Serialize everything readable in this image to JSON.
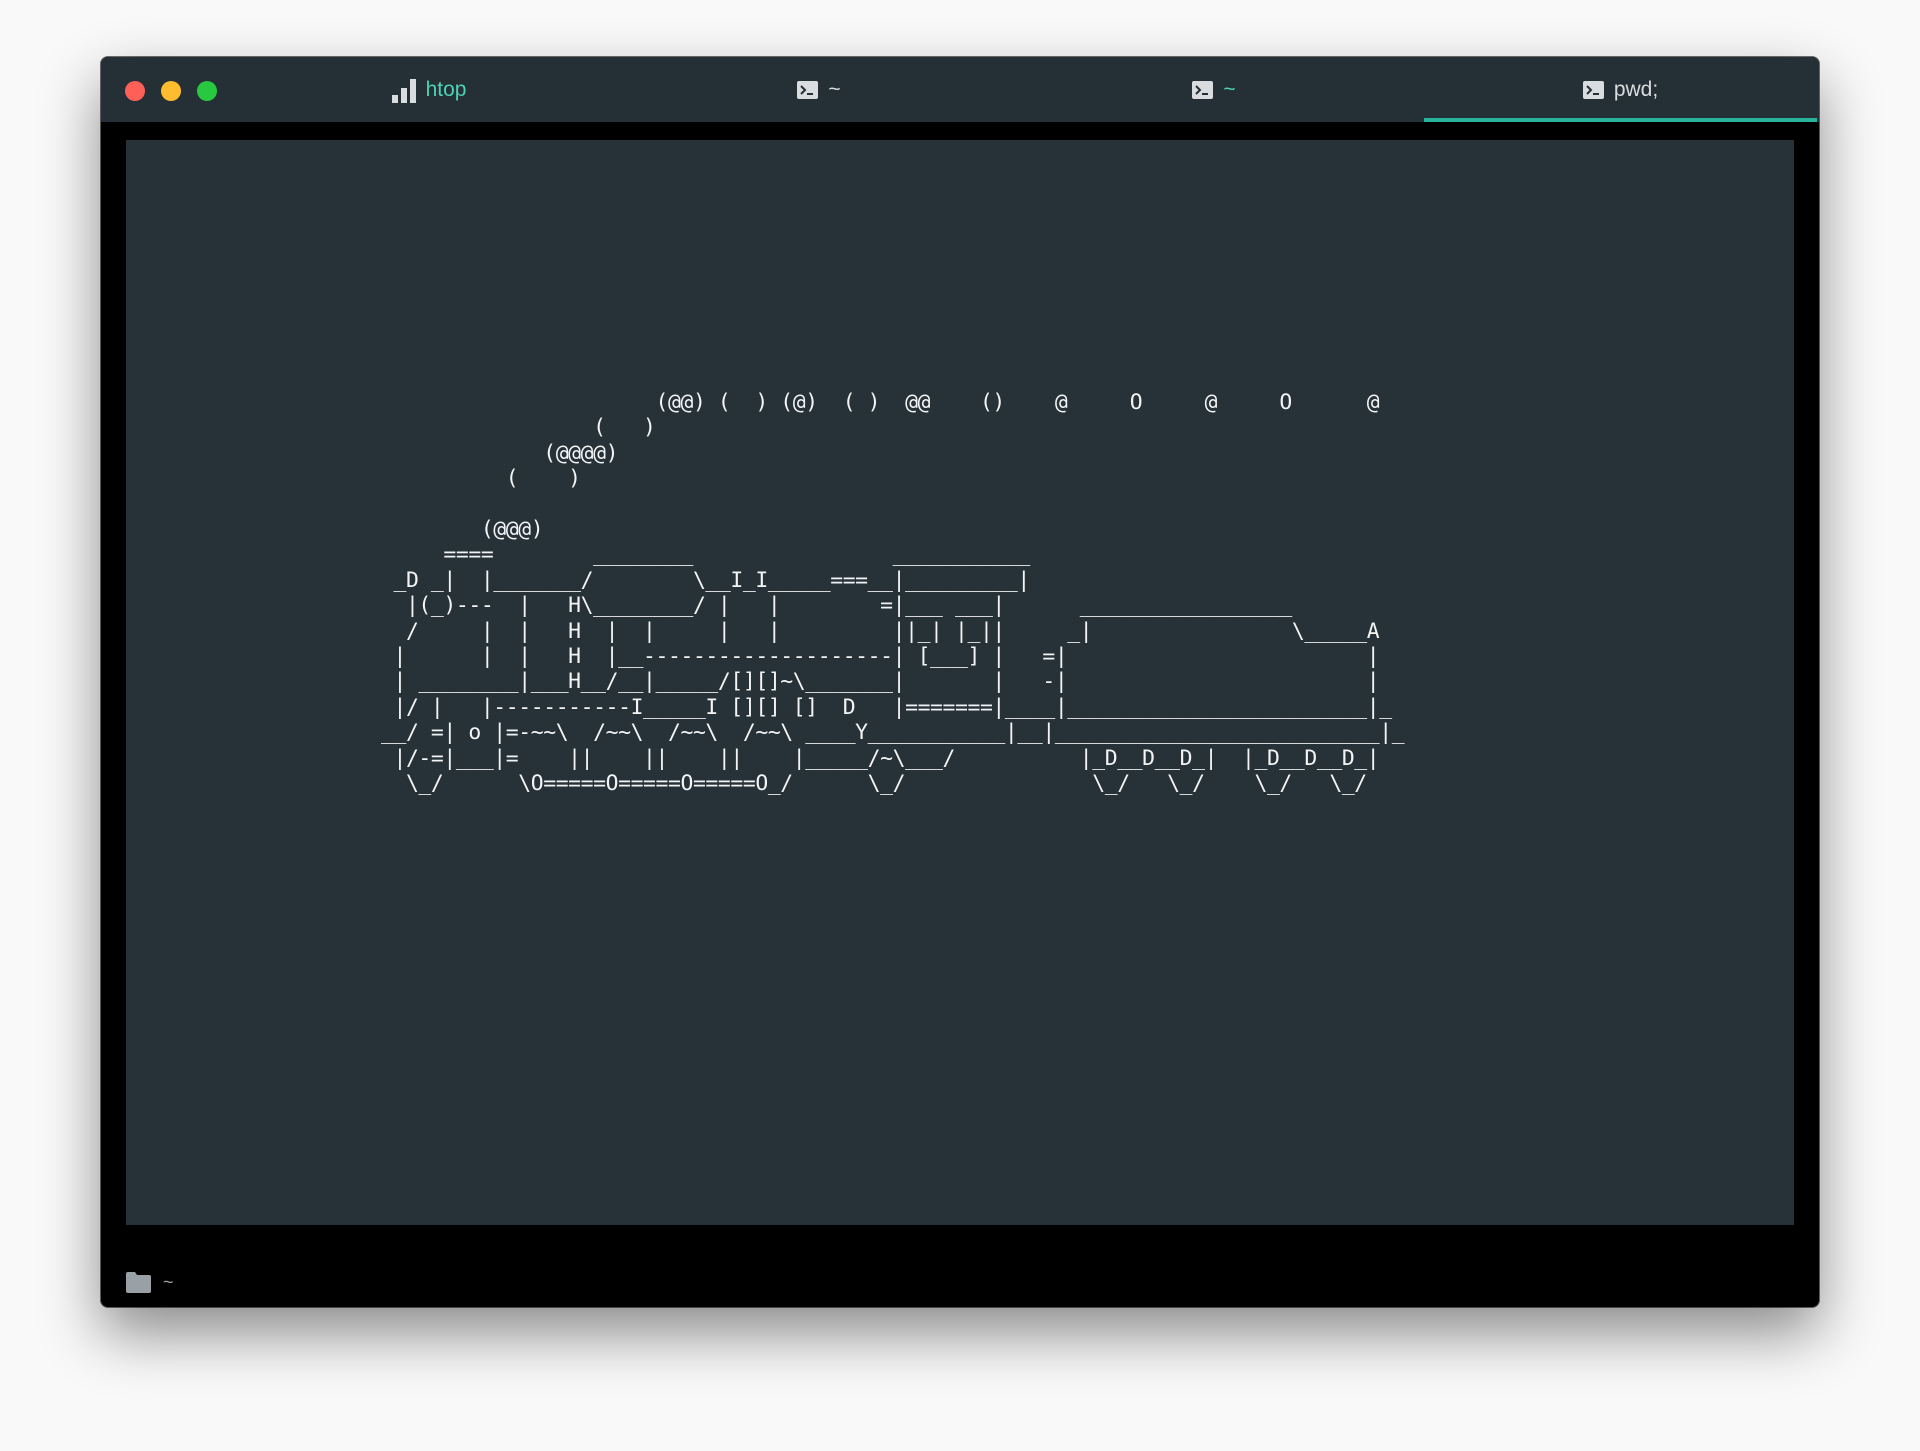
{
  "window": {
    "tabs": [
      {
        "label": "htop",
        "icon": "bar-chart-icon",
        "color": "#4ed1b4"
      },
      {
        "label": "~",
        "icon": "terminal-icon",
        "color": "#d9dde0"
      },
      {
        "label": "~",
        "icon": "terminal-icon",
        "color": "#4ed1b4"
      },
      {
        "label": "pwd;",
        "icon": "terminal-icon",
        "color": "#d9dde0",
        "active": true
      }
    ],
    "accent_color": "#27b39c"
  },
  "terminal": {
    "background": "#263238",
    "ascii_art": "                      (@@) (  ) (@)  ( )  @@    ()    @     O     @     O      @\n                 (   )\n             (@@@@)\n          (    )\n\n        (@@@)\n     ====        ________                ___________\n _D _|  |_______/        \\__I_I_____===__|_________|\n  |(_)---  |   H\\________/ |   |        =|___ ___|      _________________\n  /     |  |   H  |  |     |   |         ||_| |_||     _|                \\_____A\n |      |  |   H  |__--------------------| [___] |   =|                        |\n | ________|___H__/__|_____/[][]~\\_______|       |   -|                        |\n |/ |   |-----------I_____I [][] []  D   |=======|____|________________________|_\n__/ =| o |=-~~\\  /~~\\  /~~\\  /~~\\ ____Y___________|__|__________________________|_\n |/-=|___|=    ||    ||    ||    |_____/~\\___/          |_D__D__D_|  |_D__D__D_|\n  \\_/      \\O=====O=====O=====O_/      \\_/               \\_/   \\_/    \\_/   \\_/"
  },
  "statusbar": {
    "icon": "folder-icon",
    "path": "~"
  }
}
